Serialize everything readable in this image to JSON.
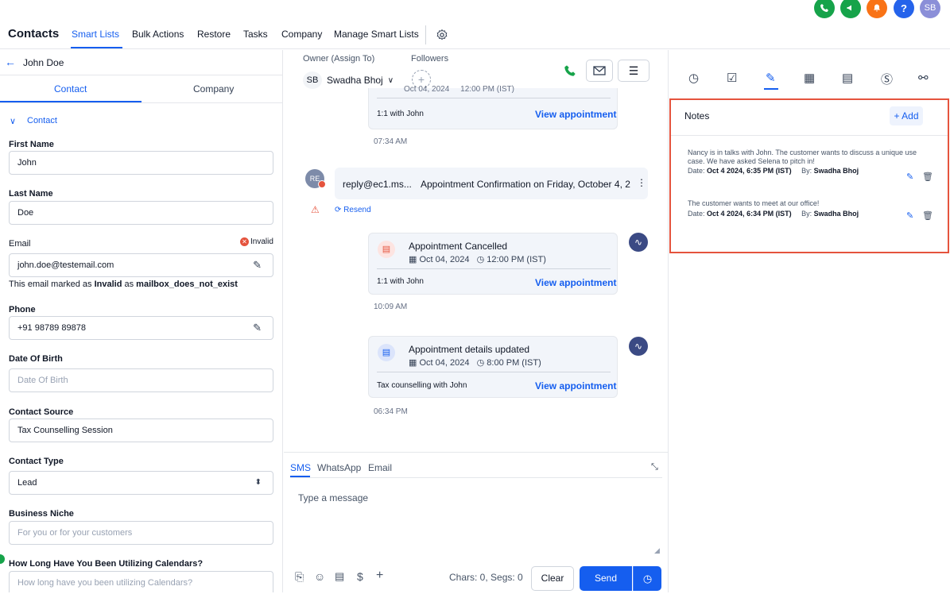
{
  "topbar": {
    "avatar": "SB",
    "help": "?"
  },
  "nav": {
    "title": "Contacts",
    "tabs": [
      "Smart Lists",
      "Bulk Actions",
      "Restore",
      "Tasks",
      "Company",
      "Manage Smart Lists"
    ]
  },
  "left": {
    "back_name": "John Doe",
    "tabs": [
      "Contact",
      "Company"
    ],
    "section": "Contact",
    "fields": {
      "first_name_label": "First Name",
      "first_name": "John",
      "last_name_label": "Last Name",
      "last_name": "Doe",
      "email_label": "Email",
      "email_badge": "Invalid",
      "email": "john.doe@testemail.com",
      "email_note_pre": "This email marked as ",
      "email_note_invalid": "Invalid",
      "email_note_mid": " as ",
      "email_note_reason": "mailbox_does_not_exist",
      "phone_label": "Phone",
      "phone": "+91 98789 89878",
      "dob_label": "Date Of Birth",
      "dob_placeholder": "Date Of Birth",
      "source_label": "Contact Source",
      "source": "Tax Counselling Session",
      "type_label": "Contact Type",
      "type": "Lead",
      "niche_label": "Business Niche",
      "niche_placeholder": "For you or for your customers",
      "calendars_label": "How Long Have You Been Utilizing Calendars?",
      "calendars_placeholder": "How long have you been utilizing Calendars?"
    }
  },
  "middle": {
    "owner_label": "Owner (Assign To)",
    "owner_initials": "SB",
    "owner_name": "Swadha Bhoj",
    "followers_label": "Followers",
    "card0": {
      "date": "Oct 04, 2024",
      "time": "12:00 PM (IST)",
      "meeting": "1:1 with John",
      "link": "View appointment",
      "stamp": "07:34 AM"
    },
    "email": {
      "initials": "RE",
      "from": "reply@ec1.ms...",
      "subject": "Appointment Confirmation on Friday, October 4, 2",
      "resend": "Resend"
    },
    "card1": {
      "title": "Appointment Cancelled",
      "date": "Oct 04, 2024",
      "time": "12:00 PM (IST)",
      "meeting": "1:1 with John",
      "link": "View appointment",
      "stamp": "10:09 AM"
    },
    "card2": {
      "title": "Appointment details updated",
      "date": "Oct 04, 2024",
      "time": "8:00 PM (IST)",
      "meeting": "Tax counselling with John",
      "link": "View appointment",
      "stamp": "06:34 PM"
    },
    "composer": {
      "tabs": [
        "SMS",
        "WhatsApp",
        "Email"
      ],
      "placeholder": "Type a message",
      "chars": "Chars: 0, Segs: 0",
      "clear": "Clear",
      "send": "Send"
    }
  },
  "right": {
    "notes_title": "Notes",
    "add": "+ Add",
    "notes": [
      {
        "text": "Nancy is in talks with John. The customer wants to discuss a unique use case. We have asked Selena to pitch in!",
        "date_label": "Date:",
        "date": "Oct 4 2024, 6:35 PM (IST)",
        "by_label": "By:",
        "by": "Swadha Bhoj"
      },
      {
        "text": "The customer wants to meet at our office!",
        "date_label": "Date:",
        "date": "Oct 4 2024, 6:34 PM (IST)",
        "by_label": "By:",
        "by": "Swadha Bhoj"
      }
    ]
  },
  "colors": {
    "accent": "#155eef",
    "highlight": "#e5533d"
  }
}
